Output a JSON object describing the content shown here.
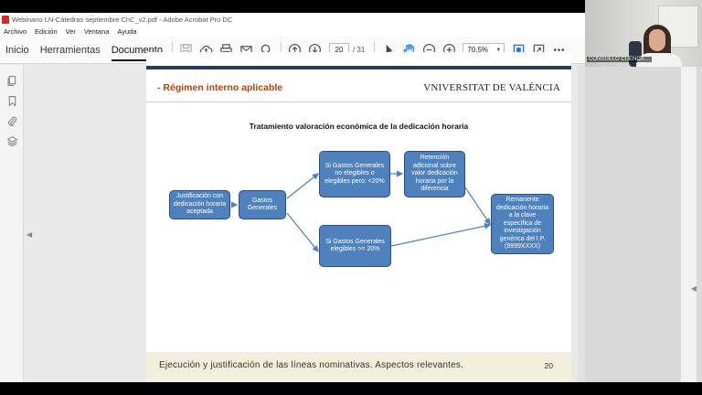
{
  "window": {
    "title": "Webinario LN-Cátedras septiembre ChC_v2.pdf - Adobe Acrobat Pro DC"
  },
  "menu": [
    "Archivo",
    "Edición",
    "Ver",
    "Ventana",
    "Ayuda"
  ],
  "tabs": {
    "inicio": "Inicio",
    "herramientas": "Herramientas",
    "documento": "Documento"
  },
  "navigation": {
    "current_page": "20",
    "total_pages": "/ 31",
    "zoom": "70,5%"
  },
  "slide": {
    "heading": "- Régimen interno aplicable",
    "logo_text": "VNIVERSITAT DE VALÈNCIA",
    "diagram_title": "Tratamiento valoración económica de la dedicación horaria",
    "boxes": {
      "justificacion": "Justificación con dedicación horaria aceptada",
      "gastos": "Gastos Generales",
      "no_elegibles": "Si Gastos Generales no elegibles o elegibles pero: <20%",
      "retencion": "Retención adicional sobre valor dedicación horaria por la diferencia",
      "elegibles": "Si Gastos Generales elegibles >= 20%",
      "remanente": "Remanente dedicación horaria a la clave específica de investigación genérica del I.P. (9999XXXX)"
    },
    "footer_text": "Ejecución y justificación de las líneas  nominativas. Aspectos relevantes.",
    "page_number": "20"
  },
  "webcam": {
    "participant_name": "CONSUELO CUENCA ..."
  },
  "colors": {
    "box_fill": "#4f81bd",
    "box_border": "#294f7d",
    "heading": "#b0440c",
    "slide_bar": "#2b3a57",
    "footer_bg": "#f2efdc"
  }
}
